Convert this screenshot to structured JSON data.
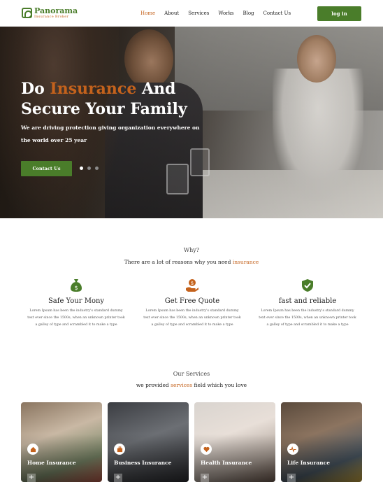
{
  "brand": {
    "name": "Panorama",
    "tagline": "Insurance Broker"
  },
  "nav": {
    "items": [
      "Home",
      "About",
      "Services",
      "Works",
      "Blog",
      "Contact Us"
    ],
    "active": "Home",
    "login_label": "log in"
  },
  "hero": {
    "title_part1": "Do ",
    "title_accent": "Insurance",
    "title_part2": " And",
    "title_line2": "Secure Your Family",
    "subtitle": "We are driving protection giving organization everywhere on the world over 25 year",
    "cta_label": "Contact Us",
    "slide_count": 3,
    "active_slide": 1
  },
  "why": {
    "label": "Why?",
    "heading_pre": "There are a lot of reasons why you need ",
    "heading_accent": "insurance",
    "features": [
      {
        "icon": "money-bag-icon",
        "title": "Safe Your Mony",
        "text": "Lorem Ipsum has been the industry's standard dummy text ever since the 1500s, when an unknown printer took a galley of type and scrambled it to make a type"
      },
      {
        "icon": "hand-coin-icon",
        "title": "Get Free Quote",
        "text": "Lorem Ipsum has been the industry's standard dummy text ever since the 1500s, when an unknown printer took a galley of type and scrambled it to make a type"
      },
      {
        "icon": "shield-check-icon",
        "title": "fast and reliable",
        "text": "Lorem Ipsum has been the industry's standard dummy text ever since the 1500s, when an unknown printer took a galley of type and scrambled it to make a type"
      }
    ]
  },
  "services": {
    "label": "Our Services",
    "heading_pre": "we provided ",
    "heading_accent": "services",
    "heading_post": " field which you love",
    "cards": [
      {
        "title": "Home Insurance",
        "icon": "house-icon"
      },
      {
        "title": "Business Insurance",
        "icon": "briefcase-icon"
      },
      {
        "title": "Health Insurance",
        "icon": "heart-icon"
      },
      {
        "title": "Life Insurance",
        "icon": "pulse-icon"
      }
    ],
    "plus_label": "+"
  },
  "colors": {
    "green": "#4a7d2a",
    "orange": "#c4621c"
  }
}
